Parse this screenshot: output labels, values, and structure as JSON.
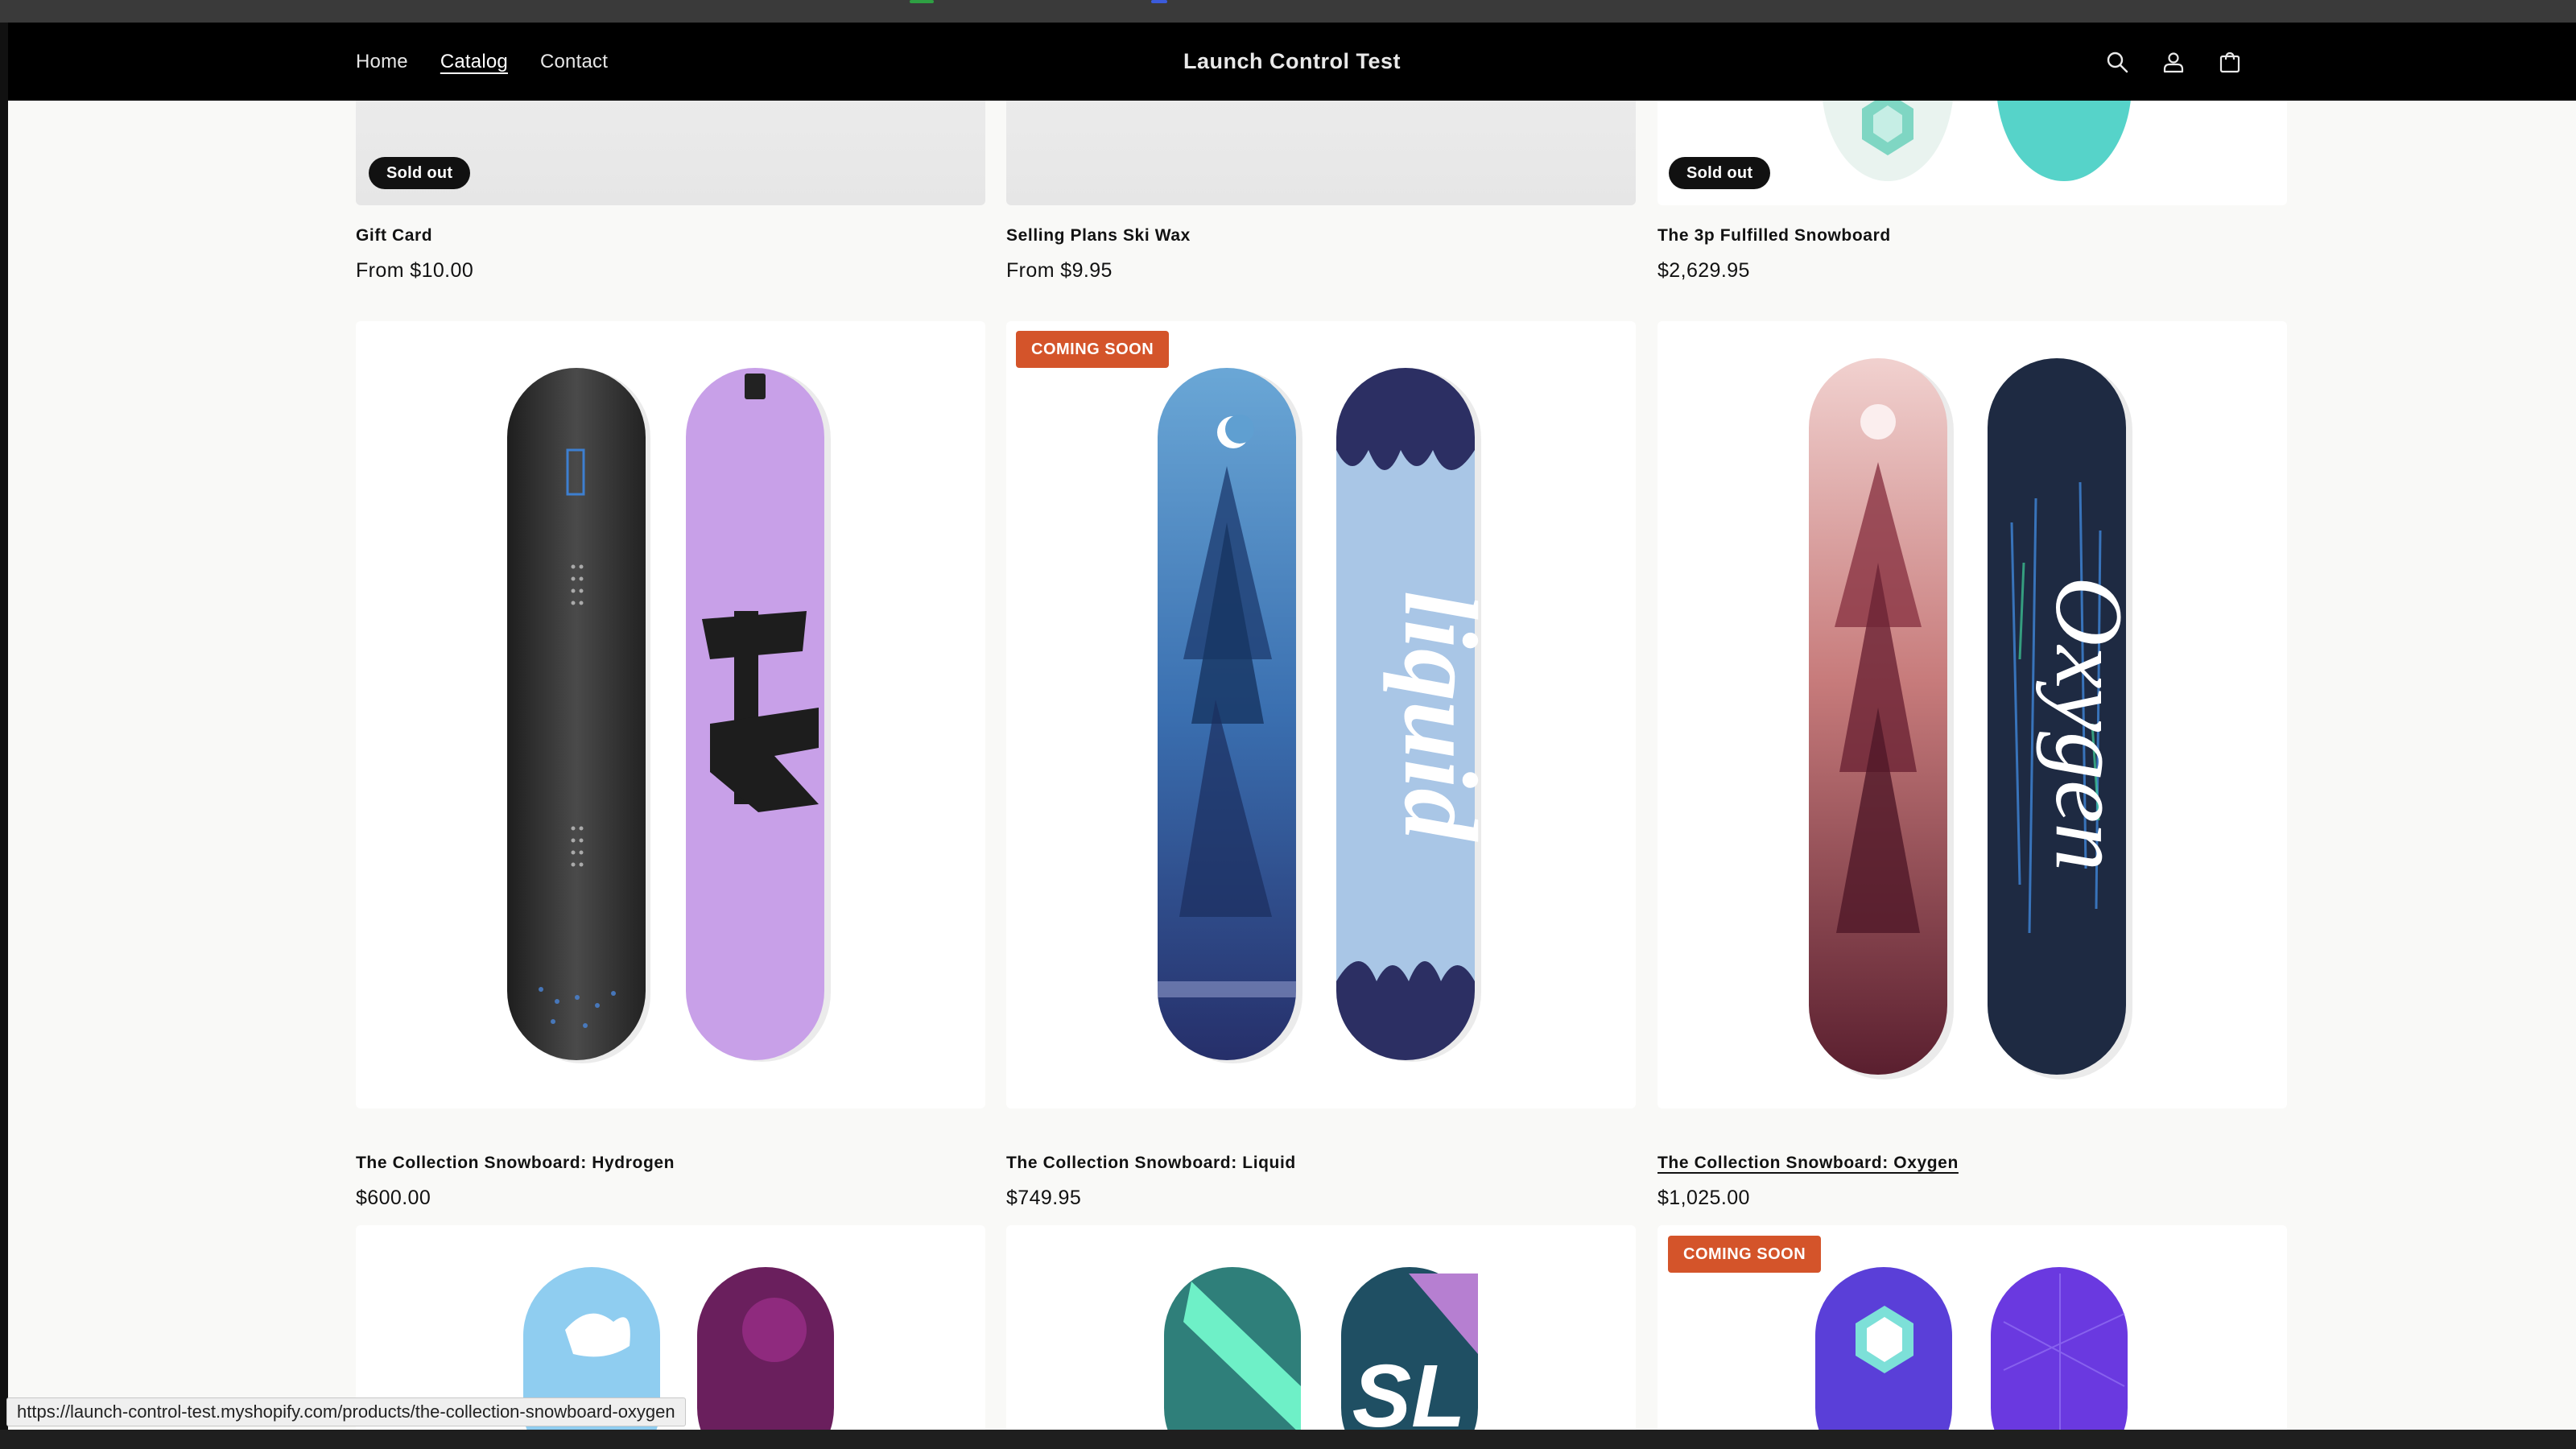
{
  "header": {
    "nav": [
      "Home",
      "Catalog",
      "Contact"
    ],
    "active_nav": "Catalog",
    "brand": "Launch Control Test",
    "icons": [
      "search-icon",
      "account-icon",
      "cart-icon"
    ]
  },
  "products": [
    {
      "title": "Gift Card",
      "price": "From $10.00",
      "badge": "Sold out"
    },
    {
      "title": "Selling Plans Ski Wax",
      "price": "From $9.95",
      "badge": ""
    },
    {
      "title": "The 3p Fulfilled Snowboard",
      "price": "$2,629.95",
      "badge": "Sold out"
    },
    {
      "title": "The Collection Snowboard: Hydrogen",
      "price": "$600.00",
      "badge": ""
    },
    {
      "title": "The Collection Snowboard: Liquid",
      "price": "$749.95",
      "badge": "COMING SOON"
    },
    {
      "title": "The Collection Snowboard: Oxygen",
      "price": "$1,025.00",
      "badge": ""
    },
    {
      "title": "",
      "price": "",
      "badge": ""
    },
    {
      "title": "",
      "price": "",
      "badge": ""
    },
    {
      "title": "",
      "price": "",
      "badge": "COMING SOON"
    }
  ],
  "status_bar": {
    "url": "https://launch-control-test.myshopify.com/products/the-collection-snowboard-oxygen"
  },
  "colors": {
    "header_bg": "#000000",
    "page_bg": "#f9f9f7",
    "badge_soon": "#d4542a",
    "badge_sold": "#111111"
  }
}
